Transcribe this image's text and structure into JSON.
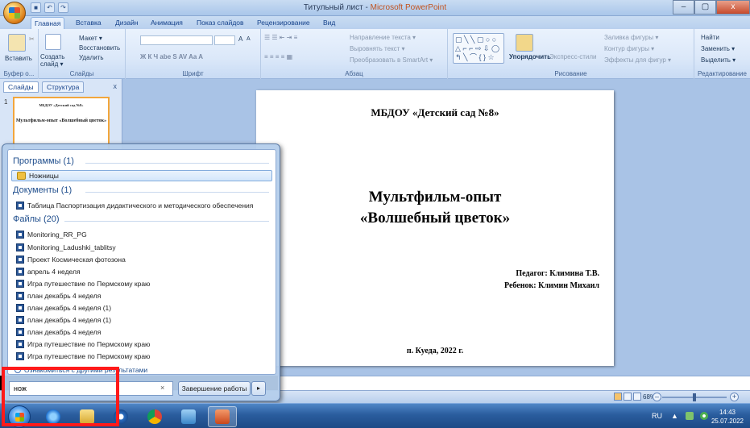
{
  "window": {
    "doc_name": "Титульный лист",
    "separator": " - ",
    "app_name": "Microsoft PowerPoint",
    "minimize": "–",
    "maximize": "▢",
    "close": "x"
  },
  "ribbon_tabs": [
    "Главная",
    "Вставка",
    "Дизайн",
    "Анимация",
    "Показ слайдов",
    "Рецензирование",
    "Вид"
  ],
  "ribbon": {
    "clipboard": {
      "paste": "Вставить",
      "label": "Буфер о...",
      "cut": "✂"
    },
    "slides": {
      "new_slide": "Создать слайд ▾",
      "layout": "Макет ▾",
      "reset": "Восстановить",
      "delete": "Удалить",
      "label": "Слайды"
    },
    "font": {
      "label": "Шрифт",
      "grow": "A",
      "shrink": "A",
      "clear": "A"
    },
    "paragraph": {
      "label": "Абзац",
      "text_direction": "Направление текста ▾",
      "align_text": "Выровнять текст ▾",
      "convert_smartart": "Преобразовать в SmartArt ▾"
    },
    "drawing": {
      "label": "Рисование",
      "arrange": "Упорядочить",
      "quick_styles": "Экспресс-стили",
      "fill": "Заливка фигуры ▾",
      "outline": "Контур фигуры ▾",
      "effects": "Эффекты для фигур ▾"
    },
    "editing": {
      "label": "Редактирование",
      "find": "Найти",
      "replace": "Заменить ▾",
      "select": "Выделить ▾"
    }
  },
  "left_panel": {
    "tab_slides": "Слайды",
    "tab_outline": "Структура",
    "close": "x",
    "slide_number": "1",
    "thumb_header": "МБДОУ «Детский сад №8»",
    "thumb_title": "Мультфильм-опыт «Волшебный цветок»"
  },
  "slide": {
    "header": "МБДОУ «Детский сад №8»",
    "title_line1": "Мультфильм-опыт",
    "title_line2": "«Волшебный цветок»",
    "author_line1": "Педагог: Климина  Т.В.",
    "author_line2": "Ребенок: Климин Михаил",
    "footer": "п. Куеда, 2022 г."
  },
  "statusbar": {
    "zoom": "68%",
    "zoom_out": "–",
    "zoom_in": "+"
  },
  "start_menu": {
    "programs_header": "Программы (1)",
    "programs": [
      "Ножницы"
    ],
    "documents_header": "Документы (1)",
    "documents": [
      "Таблица Паспортизация дидактического и методического обеспечения"
    ],
    "files_header": "Файлы (20)",
    "files": [
      "Monitoring_RR_PG",
      "Monitoring_Ladushki_tablitsy",
      "Проект Космическая фотозона",
      "апрель 4 неделя",
      "Игра путешествие по Пермскому краю",
      "план декабрь 4 неделя",
      "план декабрь 4 неделя (1)",
      "план декабрь 4 неделя (1)",
      "план декабрь 4 неделя",
      "Игра путешествие по Пермскому краю",
      "Игра путешествие по Пермскому краю"
    ],
    "see_more": "Ознакомиться с другими результатами",
    "search_value": "нож",
    "search_clear": "×",
    "shutdown": "Завершение работы",
    "shutdown_arrow": "▸"
  },
  "taskbar": {
    "language": "RU",
    "time": "14:43",
    "date": "25.07.2022",
    "tray_arrow": "▲"
  },
  "colors": {
    "highlight_box": "#ff1a1a",
    "taskbar": "#2a5d9e",
    "powerpoint_accent": "#c2531f"
  }
}
